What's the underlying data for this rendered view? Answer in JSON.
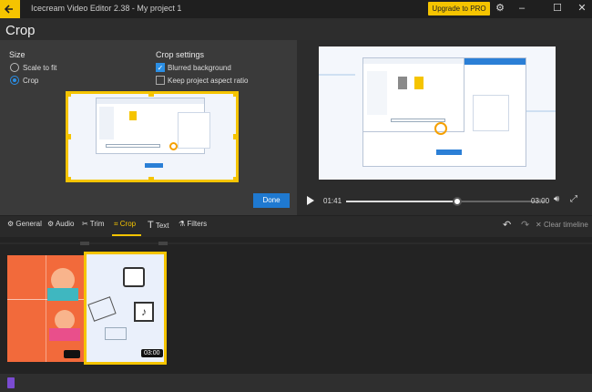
{
  "titlebar": {
    "app_title": "Icecream Video Editor 2.38  -  My project 1",
    "upgrade_label": "Upgrade to PRO"
  },
  "page": {
    "title": "Crop"
  },
  "size": {
    "heading": "Size",
    "options": [
      "Scale to fit",
      "Crop"
    ],
    "selected": "Crop"
  },
  "crop_settings": {
    "heading": "Crop settings",
    "blurred_background": {
      "label": "Blurred background",
      "checked": true
    },
    "keep_aspect": {
      "label": "Keep project aspect ratio",
      "checked": false
    }
  },
  "done_label": "Done",
  "player": {
    "current_time": "01:41",
    "duration": "03:00",
    "progress": 0.56
  },
  "tabs": [
    {
      "label": "General",
      "icon": "gear-icon"
    },
    {
      "label": "Audio",
      "icon": "audio-icon"
    },
    {
      "label": "Trim",
      "icon": "scissors-icon"
    },
    {
      "label": "Crop",
      "icon": "crop-icon",
      "active": true
    },
    {
      "label": "Text",
      "icon": "text-icon"
    },
    {
      "label": "Filters",
      "icon": "filters-icon"
    }
  ],
  "clear_timeline_label": "Clear timeline",
  "clips": [
    {
      "badge": ""
    },
    {
      "badge": "03:00"
    }
  ],
  "colors": {
    "accent": "#f5c400",
    "primary": "#1f79d0"
  }
}
